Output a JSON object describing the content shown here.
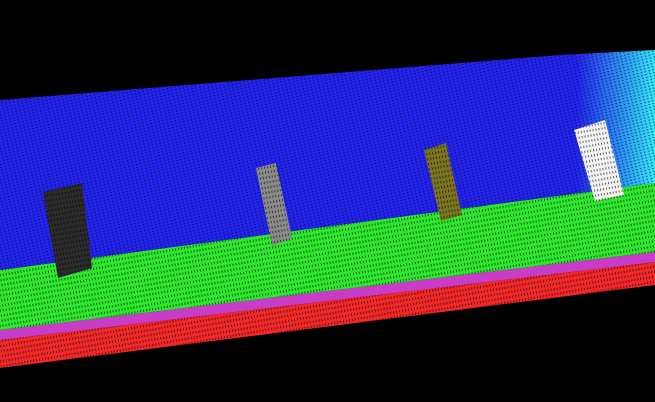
{
  "scene": {
    "background_color": "#000000",
    "wall_color": "#2323f0",
    "wall_highlight_color": "#33e6ff",
    "floor_color": "#2ee62e",
    "edge_stripe_color": "#c83cc8",
    "base_color": "#f02828",
    "objects": [
      {
        "name": "black-block",
        "color": "#2b2b2b"
      },
      {
        "name": "gray-block",
        "color": "#8a8a8a"
      },
      {
        "name": "olive-block",
        "color": "#7a7420"
      },
      {
        "name": "white-block",
        "color": "#f2f2f2"
      }
    ]
  }
}
